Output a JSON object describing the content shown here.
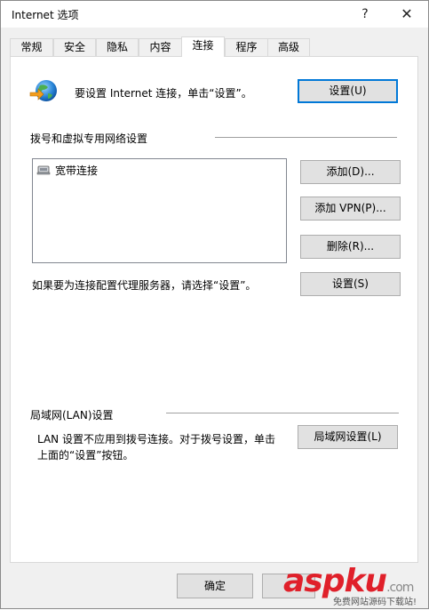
{
  "window": {
    "title": "Internet 选项",
    "help_label": "?",
    "close_label": "✕"
  },
  "tabs": [
    {
      "label": "常规"
    },
    {
      "label": "安全"
    },
    {
      "label": "隐私"
    },
    {
      "label": "内容"
    },
    {
      "label": "连接",
      "active": true
    },
    {
      "label": "程序"
    },
    {
      "label": "高级"
    }
  ],
  "connection": {
    "setup_text": "要设置 Internet 连接，单击“设置”。",
    "setup_button": "设置(U)"
  },
  "dialup": {
    "section_title": "拨号和虚拟专用网络设置",
    "items": [
      {
        "label": "宽带连接"
      }
    ],
    "add_button": "添加(D)...",
    "add_vpn_button": "添加 VPN(P)...",
    "remove_button": "删除(R)...",
    "proxy_text": "如果要为连接配置代理服务器，请选择“设置”。",
    "settings_button": "设置(S)"
  },
  "lan": {
    "section_title": "局域网(LAN)设置",
    "description_line1": "LAN 设置不应用到拨号连接。对于拨号设置，单击",
    "description_line2": "上面的“设置”按钮。",
    "lan_settings_button": "局域网设置(L)"
  },
  "footer": {
    "ok_button": "确定"
  },
  "watermark": {
    "main": "aspku",
    "suffix": ".com",
    "sub": "免费网站源码下载站!"
  }
}
